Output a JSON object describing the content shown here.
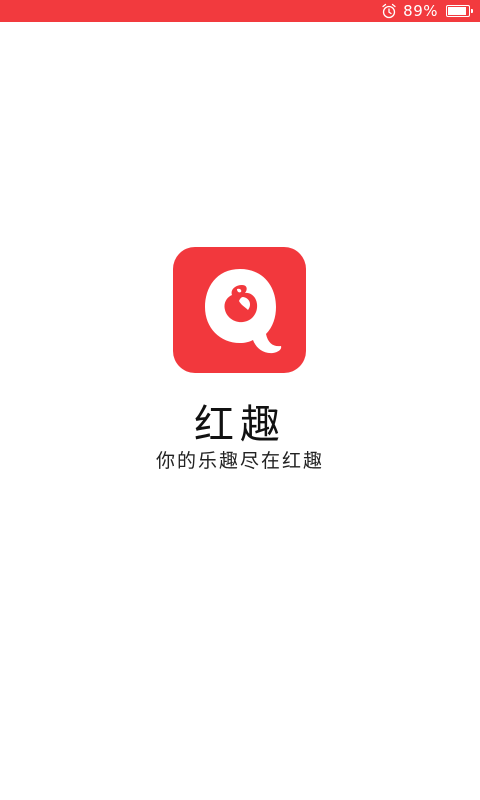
{
  "status_bar": {
    "background": "#f23a3e",
    "alarm_icon": "alarm-clock-icon",
    "battery_percent": "89%",
    "battery_level": 0.89
  },
  "splash": {
    "logo_icon": "q-logo-icon",
    "logo_color": "#f2383d",
    "app_name": "红趣",
    "slogan": "你的乐趣尽在红趣"
  }
}
